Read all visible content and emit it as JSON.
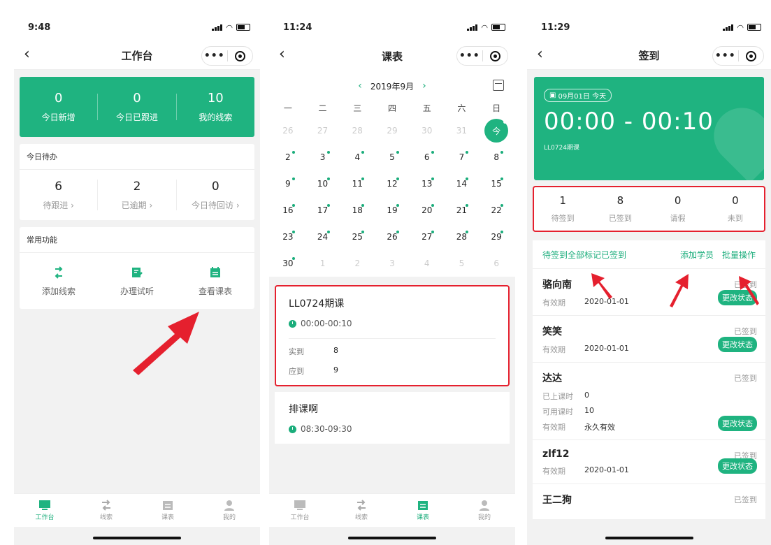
{
  "phone1": {
    "time": "9:48",
    "title": "工作台",
    "stats": [
      {
        "value": "0",
        "label": "今日新增"
      },
      {
        "value": "0",
        "label": "今日已跟进"
      },
      {
        "value": "10",
        "label": "我的线索"
      }
    ],
    "todo_title": "今日待办",
    "todos": [
      {
        "value": "6",
        "label": "待跟进 ›"
      },
      {
        "value": "2",
        "label": "已逾期 ›"
      },
      {
        "value": "0",
        "label": "今日待回访 ›"
      }
    ],
    "func_title": "常用功能",
    "funcs": [
      {
        "label": "添加线索",
        "icon": "add-lead-icon"
      },
      {
        "label": "办理试听",
        "icon": "trial-icon"
      },
      {
        "label": "查看课表",
        "icon": "schedule-icon"
      }
    ]
  },
  "phone2": {
    "time": "11:24",
    "title": "课表",
    "month": "2019年9月",
    "weekdays": [
      "一",
      "二",
      "三",
      "四",
      "五",
      "六",
      "日"
    ],
    "days": [
      {
        "d": "26",
        "dim": true
      },
      {
        "d": "27",
        "dim": true
      },
      {
        "d": "28",
        "dim": true
      },
      {
        "d": "29",
        "dim": true
      },
      {
        "d": "30",
        "dim": true
      },
      {
        "d": "31",
        "dim": true
      },
      {
        "d": "今",
        "today": true
      },
      {
        "d": "2",
        "dot": true
      },
      {
        "d": "3",
        "dot": true
      },
      {
        "d": "4",
        "dot": true
      },
      {
        "d": "5",
        "dot": true
      },
      {
        "d": "6",
        "dot": true
      },
      {
        "d": "7",
        "dot": true
      },
      {
        "d": "8",
        "dot": true
      },
      {
        "d": "9",
        "dot": true
      },
      {
        "d": "10",
        "dot": true
      },
      {
        "d": "11",
        "dot": true
      },
      {
        "d": "12",
        "dot": true
      },
      {
        "d": "13",
        "dot": true
      },
      {
        "d": "14",
        "dot": true
      },
      {
        "d": "15",
        "dot": true
      },
      {
        "d": "16",
        "dot": true
      },
      {
        "d": "17",
        "dot": true
      },
      {
        "d": "18",
        "dot": true
      },
      {
        "d": "19",
        "dot": true
      },
      {
        "d": "20",
        "dot": true
      },
      {
        "d": "21",
        "dot": true
      },
      {
        "d": "22",
        "dot": true
      },
      {
        "d": "23",
        "dot": true
      },
      {
        "d": "24",
        "dot": true
      },
      {
        "d": "25",
        "dot": true
      },
      {
        "d": "26",
        "dot": true
      },
      {
        "d": "27",
        "dot": true
      },
      {
        "d": "28",
        "dot": true
      },
      {
        "d": "29",
        "dot": true
      },
      {
        "d": "30",
        "dot": true
      },
      {
        "d": "1",
        "dim": true
      },
      {
        "d": "2",
        "dim": true
      },
      {
        "d": "3",
        "dim": true
      },
      {
        "d": "4",
        "dim": true
      },
      {
        "d": "5",
        "dim": true
      },
      {
        "d": "6",
        "dim": true
      }
    ],
    "course1": {
      "name": "LL0724期课",
      "time": "00:00-00:10",
      "actual_label": "实到",
      "actual": "8",
      "expected_label": "应到",
      "expected": "9"
    },
    "course2": {
      "name": "排课啊",
      "time": "08:30-09:30"
    }
  },
  "phone3": {
    "time": "11:29",
    "title": "签到",
    "date_badge": "09月01日 今天",
    "time_range": "00:00 - 00:10",
    "course_name": "LL0724期课",
    "summary": [
      {
        "value": "1",
        "label": "待签到"
      },
      {
        "value": "8",
        "label": "已签到"
      },
      {
        "value": "0",
        "label": "请假"
      },
      {
        "value": "0",
        "label": "未到"
      }
    ],
    "action_left": "待签到全部标记已签到",
    "action_add": "添加学员",
    "action_batch": "批量操作",
    "change_label": "更改状态",
    "students": [
      {
        "name": "骆向南",
        "status": "已签到",
        "rows": [
          {
            "k": "有效期",
            "v": "2020-01-01"
          }
        ]
      },
      {
        "name": "笑笑",
        "status": "已签到",
        "rows": [
          {
            "k": "有效期",
            "v": "2020-01-01"
          }
        ]
      },
      {
        "name": "达达",
        "status": "已签到",
        "rows": [
          {
            "k": "已上课时",
            "v": "0"
          },
          {
            "k": "可用课时",
            "v": "10"
          },
          {
            "k": "有效期",
            "v": "永久有效"
          }
        ]
      },
      {
        "name": "zlf12",
        "status": "已签到",
        "rows": [
          {
            "k": "有效期",
            "v": "2020-01-01"
          }
        ]
      },
      {
        "name": "王二狗",
        "status": "已签到",
        "rows": []
      }
    ]
  },
  "tabs": [
    {
      "label": "工作台",
      "icon": "workbench-icon"
    },
    {
      "label": "线索",
      "icon": "leads-icon"
    },
    {
      "label": "课表",
      "icon": "calendar-icon"
    },
    {
      "label": "我的",
      "icon": "profile-icon"
    }
  ],
  "colors": {
    "accent": "#1fb380",
    "highlight": "#e5202e"
  }
}
